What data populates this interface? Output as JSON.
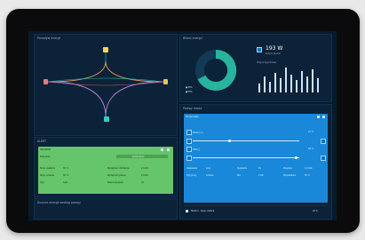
{
  "panels": {
    "flow_title": "Przepływ energii",
    "summary_title": "Bilans energii",
    "daily_title": "Pompy ciepła",
    "alert_title": "ALERT",
    "bottom_title": "Zużycie energii według pompy"
  },
  "summary": {
    "big_value": "193 W",
    "big_sub": "Zużycie łącznie",
    "bars_title": "Zużycie tygodniowe"
  },
  "alert_card": {
    "title": "HEATPUMP",
    "left_label": "Połączenie",
    "button_label": "Zarządzanie",
    "row1_label": "Temp. zasilania",
    "row1_value": "35 °C",
    "row1b_label": "Wydajność chłodzenia",
    "row1b_value": "1.0 kW",
    "row2_label": "Temp. powrotu",
    "row2_value": "30 °C",
    "row2b_label": "Wydajność grzania",
    "row2b_value": "2.0 kW",
    "row3_label": "Tryb",
    "row3_value": "Auto",
    "row3b_label": "Status sprężarki",
    "row3b_value": "On"
  },
  "pump_card": {
    "title": "Pompa ciepła",
    "zone1": "Strefa 1 ⓘ",
    "zone2": "CWU ⓘ",
    "zone1_value": "22 °C",
    "zone2_value": "48 °C",
    "row_labels": [
      "Ustawienia",
      "Sprężarka",
      "Przepływ",
      "Tryb pracy",
      "Moc",
      "Temperatura"
    ],
    "row_values": [
      "Auto",
      "On",
      "12 l/min",
      "Grzanie",
      "2 kW",
      "35 °C"
    ]
  },
  "bottom_card": {
    "header": "Strefa 1 – temp. zadana",
    "value": "20 %"
  },
  "colors": {
    "accent_green": "#66c46a",
    "accent_blue": "#1a88d8",
    "donut_teal": "#27b39d",
    "line_orange": "#e9a15a",
    "line_purple": "#b686d8",
    "line_teal": "#2bd1c0"
  }
}
